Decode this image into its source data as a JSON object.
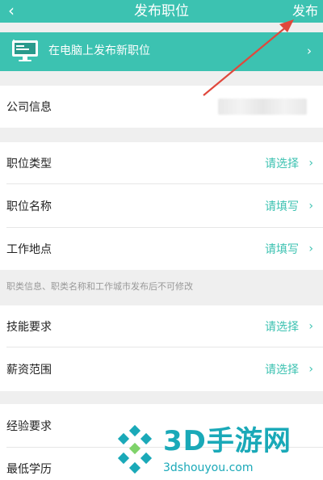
{
  "header": {
    "back_icon": "chevron-left-icon",
    "title": "发布职位",
    "publish_label": "发布"
  },
  "banner": {
    "icon": "monitor-icon",
    "text": "在电脑上发布新职位",
    "chevron": "›"
  },
  "company": {
    "label": "公司信息"
  },
  "job_section": [
    {
      "label": "职位类型",
      "value": "请选择"
    },
    {
      "label": "职位名称",
      "value": "请填写"
    },
    {
      "label": "工作地点",
      "value": "请填写"
    }
  ],
  "note": "职类信息、职类名称和工作城市发布后不可修改",
  "req_section": [
    {
      "label": "技能要求",
      "value": "请选择"
    },
    {
      "label": "薪资范围",
      "value": "请选择"
    }
  ],
  "exp_section": [
    {
      "label": "经验要求"
    },
    {
      "label": "最低学历"
    }
  ],
  "chevron": "›",
  "watermark": {
    "title": "3D手游网",
    "url": "3dshouyou.com"
  },
  "colors": {
    "accent": "#3cc2b1",
    "annotation_arrow": "#e0483c",
    "watermark": "#1aa9b8"
  }
}
